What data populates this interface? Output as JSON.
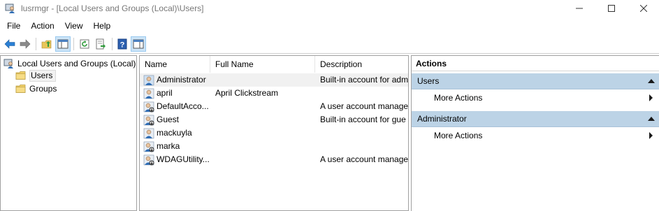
{
  "window": {
    "title": "lusrmgr - [Local Users and Groups (Local)\\Users]"
  },
  "menu": {
    "items": [
      "File",
      "Action",
      "View",
      "Help"
    ]
  },
  "toolbar": {
    "buttons": [
      "back-icon",
      "forward-icon",
      "up-folder-icon",
      "show-hide-tree-icon",
      "refresh-icon",
      "export-list-icon",
      "help-icon",
      "show-hide-action-pane-icon"
    ]
  },
  "tree": {
    "root": "Local Users and Groups (Local)",
    "children": [
      "Users",
      "Groups"
    ],
    "selected": "Users"
  },
  "list": {
    "columns": [
      "Name",
      "Full Name",
      "Description"
    ],
    "rows": [
      {
        "name": "Administrator",
        "full_name": "",
        "description": "Built-in account for adm"
      },
      {
        "name": "april",
        "full_name": "April Clickstream",
        "description": ""
      },
      {
        "name": "DefaultAcco...",
        "full_name": "",
        "description": "A user account manage"
      },
      {
        "name": "Guest",
        "full_name": "",
        "description": "Built-in account for gue"
      },
      {
        "name": "mackuyla",
        "full_name": "",
        "description": ""
      },
      {
        "name": "marka",
        "full_name": "",
        "description": ""
      },
      {
        "name": "WDAGUtility...",
        "full_name": "",
        "description": "A user account manage"
      }
    ],
    "selected_row": "Administrator"
  },
  "actions": {
    "title": "Actions",
    "sections": [
      {
        "label": "Users",
        "item": "More Actions"
      },
      {
        "label": "Administrator",
        "item": "More Actions"
      }
    ]
  },
  "colors": {
    "section_header": "#bcd3e6",
    "selected_row": "#f1f1f1",
    "accent_blue": "#1e73be"
  }
}
